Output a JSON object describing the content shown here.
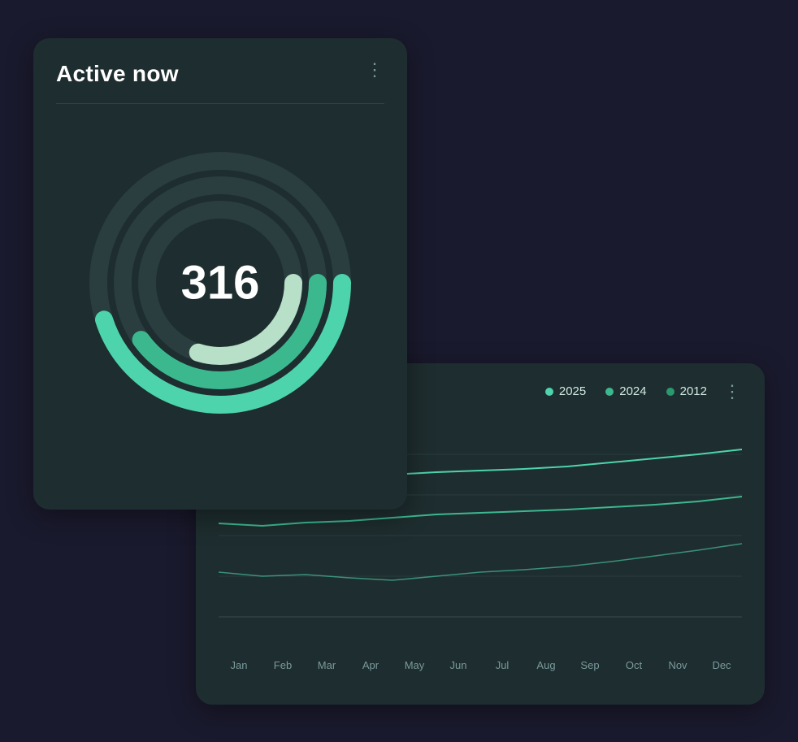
{
  "activeNow": {
    "title": "Active now",
    "value": "316",
    "moreIcon": "⋮"
  },
  "lineChart": {
    "moreIcon": "⋮",
    "legend": [
      {
        "id": "2025",
        "label": "2025",
        "dotClass": "dot-2025"
      },
      {
        "id": "2024",
        "label": "2024",
        "dotClass": "dot-2024"
      },
      {
        "id": "2012",
        "label": "2012",
        "dotClass": "dot-2012"
      }
    ],
    "xLabels": [
      "Jan",
      "Feb",
      "Mar",
      "Apr",
      "May",
      "Jun",
      "Jul",
      "Aug",
      "Sep",
      "Oct",
      "Nov",
      "Dec"
    ]
  },
  "donut": {
    "rings": [
      {
        "r": 150,
        "strokeWidth": 22,
        "dasharray": "660 940",
        "color": "#4dd4ac",
        "opacity": 1,
        "rotate": -90
      },
      {
        "r": 120,
        "strokeWidth": 22,
        "dasharray": "500 754",
        "color": "#3cb88f",
        "opacity": 0.85,
        "rotate": -90
      },
      {
        "r": 90,
        "strokeWidth": 22,
        "dasharray": "400 565",
        "color": "#c0e8d0",
        "opacity": 0.7,
        "rotate": -90
      }
    ]
  }
}
